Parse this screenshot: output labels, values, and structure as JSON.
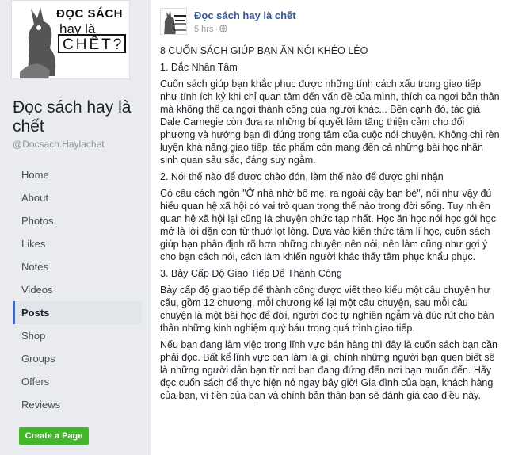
{
  "page": {
    "name": "Đọc sách hay là chết",
    "handle": "@Docsach.Haylachet",
    "logo": {
      "line1": "ĐỌC SÁCH",
      "line2": "hay là",
      "line3": "CHẾT?"
    }
  },
  "nav": [
    {
      "label": "Home",
      "active": false
    },
    {
      "label": "About",
      "active": false
    },
    {
      "label": "Photos",
      "active": false
    },
    {
      "label": "Likes",
      "active": false
    },
    {
      "label": "Notes",
      "active": false
    },
    {
      "label": "Videos",
      "active": false
    },
    {
      "label": "Posts",
      "active": true
    },
    {
      "label": "Shop",
      "active": false
    },
    {
      "label": "Groups",
      "active": false
    },
    {
      "label": "Offers",
      "active": false
    },
    {
      "label": "Reviews",
      "active": false
    }
  ],
  "create_button": "Create a Page",
  "post": {
    "author": "Đọc sách hay là chết",
    "time": "5 hrs",
    "privacy_icon": "globe-icon",
    "paragraphs": [
      "8 CUỐN SÁCH GIÚP BẠN ĂN NÓI KHÉO LÉO",
      "1. Đắc Nhân Tâm",
      "Cuốn sách giúp bạn khắc phục được những tính cách xấu trong giao tiếp như tính ích kỷ khi chỉ quan tâm đến vấn đề của mình, thích ca ngợi bản thân mà không thể ca ngợi thành công của người khác... Bên cạnh đó, tác giả Dale Carnegie còn đưa ra những bí quyết làm tăng thiện cảm cho đối phương và hướng bạn đi đúng trọng tâm của cuộc nói chuyện. Không chỉ rèn luyện khả năng giao tiếp, tác phẩm còn mang đến cả những bài học nhân sinh quan sâu sắc, đáng suy ngẫm.",
      "2. Nói thế nào để được chào đón, làm thế nào để được ghi nhận",
      "Có câu cách ngôn \"Ở nhà nhờ bố mẹ, ra ngoài cậy bạn bè\", nói như vậy đủ hiểu quan hệ xã hội có vai trò quan trọng thế nào trong đời sống. Tuy nhiên quan hệ xã hội lại cũng là chuyện phức tạp nhất. Học ăn học nói học gói học mở là lời dặn con từ thuở lọt lòng. Dựa vào kiến thức tâm lí học, cuốn sách giúp bạn phân định rõ hơn những chuyện nên nói, nên làm cũng như gợi ý cho bạn cách nói, cách làm khiến người khác thấy tâm phục khẩu phục.",
      "3. Bảy Cấp Độ Giao Tiếp Để Thành Công",
      "Bảy cấp độ giao tiếp để thành công được viết theo kiểu một câu chuyện hư cấu, gồm 12 chương, mỗi chương kể lại một câu chuyện, sau mỗi câu chuyện là một bài học để đời, người đọc tự nghiền ngẫm và đúc rút cho bản thân những kinh nghiệm quý báu trong quá trình giao tiếp.",
      "Nếu bạn đang làm việc trong lĩnh vực bán hàng thì đây là cuốn sách bạn cần phải đọc. Bất kể lĩnh vực bạn làm là gì, chính những người bạn quen biết sẽ là những người dẫn bạn từ nơi bạn đang đứng đến nơi bạn muốn đến. Hãy đọc cuốn sách để thực hiện nó ngay bây giờ! Gia đình của bạn, khách hàng của bạn, ví tiền của bạn và chính bản thân bạn sẽ đánh giá cao điều này."
    ]
  }
}
